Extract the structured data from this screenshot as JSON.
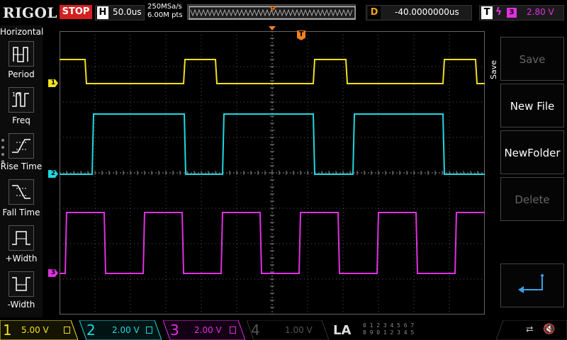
{
  "topbar": {
    "brand": "RIGOL",
    "run_state": "STOP",
    "horizontal": {
      "letter": "H",
      "timebase": "50.0us"
    },
    "sample_rate": "250MSa/s",
    "memory_depth": "6.00M pts",
    "delay": {
      "letter": "D",
      "value": "-40.0000000us"
    },
    "trigger": {
      "letter": "T",
      "edge_icon": "rising-edge-icon",
      "source": "3",
      "level": "2.80 V"
    }
  },
  "left_menu": {
    "title": "Horizontal",
    "items": [
      {
        "label": "Period",
        "icon": "period-icon"
      },
      {
        "label": "Freq",
        "icon": "freq-icon"
      },
      {
        "label": "Rise Time",
        "icon": "rise-time-icon"
      },
      {
        "label": "Fall Time",
        "icon": "fall-time-icon"
      },
      {
        "label": "+Width",
        "icon": "positive-width-icon"
      },
      {
        "label": "-Width",
        "icon": "negative-width-icon"
      }
    ]
  },
  "right_panel": {
    "title": "Save",
    "buttons": [
      {
        "label": "Save",
        "enabled": false
      },
      {
        "label": "New File",
        "enabled": true
      },
      {
        "label": "NewFolder",
        "enabled": true
      },
      {
        "label": "Delete",
        "enabled": false
      }
    ],
    "enter_icon": "enter-arrow-icon"
  },
  "markers": {
    "ch1": "1",
    "ch2": "2",
    "ch3": "3",
    "trigger_top": "T",
    "trigger_level": "T"
  },
  "channels": [
    {
      "num": "1",
      "scale": "5.00 V",
      "color": "#f0e020",
      "active": true
    },
    {
      "num": "2",
      "scale": "2.00 V",
      "color": "#20d8e0",
      "active": true
    },
    {
      "num": "3",
      "scale": "2.00 V",
      "color": "#e030e0",
      "active": true
    },
    {
      "num": "4",
      "scale": "1.00 V",
      "color": "#4060d0",
      "active": false
    }
  ],
  "la": {
    "label": "LA",
    "bits_row1": "0 1 2 3  4 5 6 7",
    "bits_row2": "8 9 0 1  2 3 4 5"
  },
  "status_icons": {
    "usb": "usb-icon",
    "sound": "speaker-muted-icon"
  },
  "colors": {
    "ch1": "#f0e020",
    "ch2": "#20d8e0",
    "ch3": "#e030e0",
    "ch4": "#4060d0",
    "trigger": "#f08020",
    "stop": "#d42020"
  }
}
